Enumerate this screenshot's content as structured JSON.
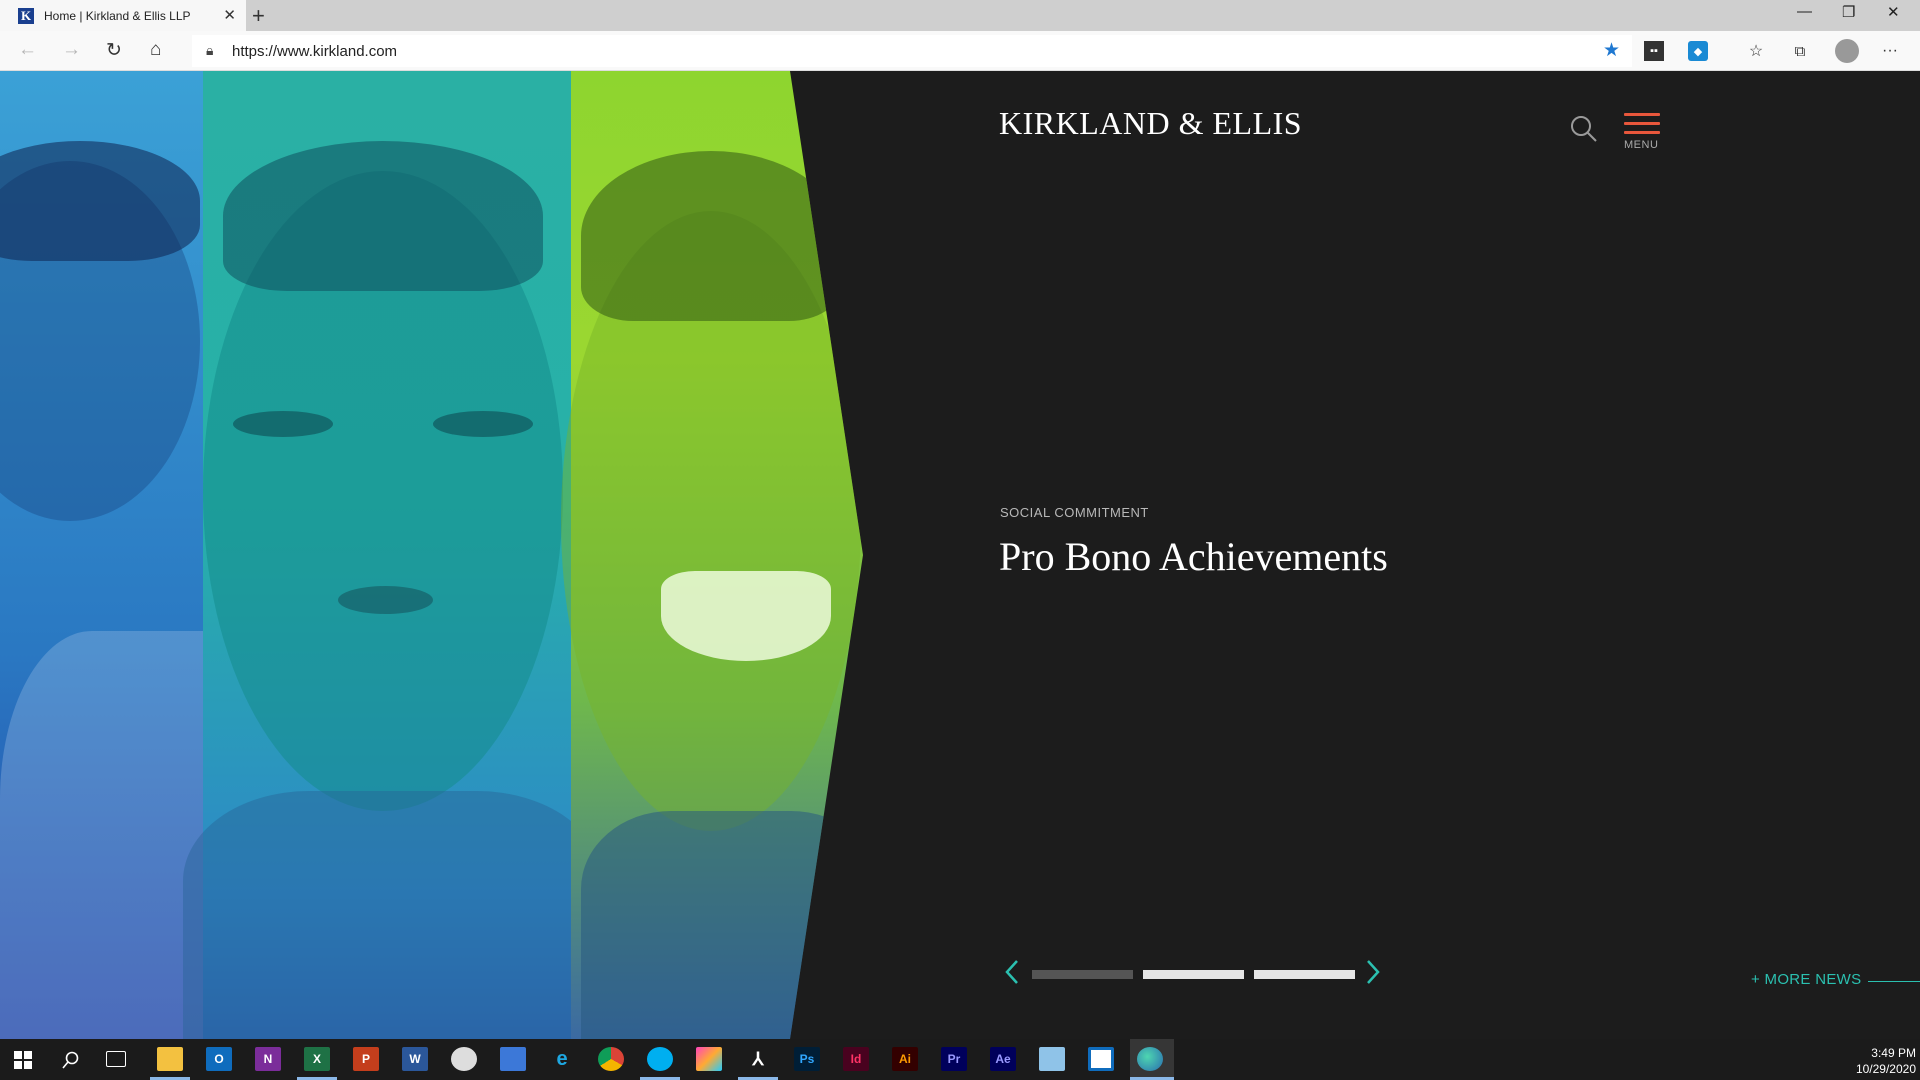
{
  "browser": {
    "tab_title": "Home | Kirkland & Ellis LLP",
    "favicon_letter": "K",
    "tab_close": "✕",
    "new_tab": "+",
    "url": "https://www.kirkland.com",
    "window_controls": {
      "minimize": "—",
      "restore": "❐",
      "close": "✕"
    },
    "more_menu": "···"
  },
  "site": {
    "logo": "KIRKLAND & ELLIS",
    "menu_label": "MENU",
    "accent_color": "#e8573c",
    "teal_color": "#2bc0b0"
  },
  "hero": {
    "eyebrow": "SOCIAL COMMITMENT",
    "headline": "Pro Bono Achievements",
    "active_slide": 0,
    "slide_count": 3,
    "more_news": "+ MORE NEWS"
  },
  "taskbar": {
    "icons": [
      "windows-start",
      "search",
      "task-view",
      "file-explorer",
      "outlook",
      "onenote",
      "excel",
      "powerpoint",
      "word",
      "clock-app",
      "notepad",
      "internet-explorer",
      "chrome",
      "skype",
      "creative-cloud",
      "acrobat",
      "photoshop",
      "indesign",
      "illustrator",
      "premiere",
      "after-effects",
      "paint",
      "outlook-calendar",
      "edge"
    ],
    "labels": {
      "outlook": "O",
      "onenote": "N",
      "excel": "X",
      "powerpoint": "P",
      "word": "W",
      "photoshop": "Ps",
      "indesign": "Id",
      "illustrator": "Ai",
      "premiere": "Pr",
      "after_effects": "Ae"
    },
    "time": "3:49 PM",
    "date": "10/29/2020"
  }
}
